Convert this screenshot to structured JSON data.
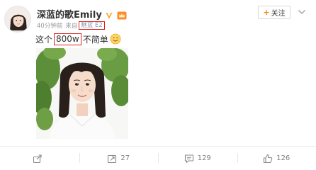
{
  "post": {
    "username": "深蓝的歌Emily",
    "meta": {
      "time": "40分钟前",
      "source_prefix": "来自",
      "device": "魅蓝 E2"
    },
    "follow_label": "关注",
    "text_prefix": "这个",
    "text_highlight": "800w",
    "text_suffix": "不简单"
  },
  "actions": {
    "share_count": "",
    "repost_count": "27",
    "comment_count": "129",
    "like_count": "126"
  },
  "colors": {
    "highlight_border": "#e02020",
    "follow_plus": "#ff8200",
    "verified_badge": "#f5a623"
  },
  "icons": [
    "avatar",
    "verified-v-icon",
    "crown-icon",
    "more-chevron-icon",
    "smile-emoji-icon",
    "share-icon",
    "repost-icon",
    "comment-icon",
    "like-icon"
  ]
}
